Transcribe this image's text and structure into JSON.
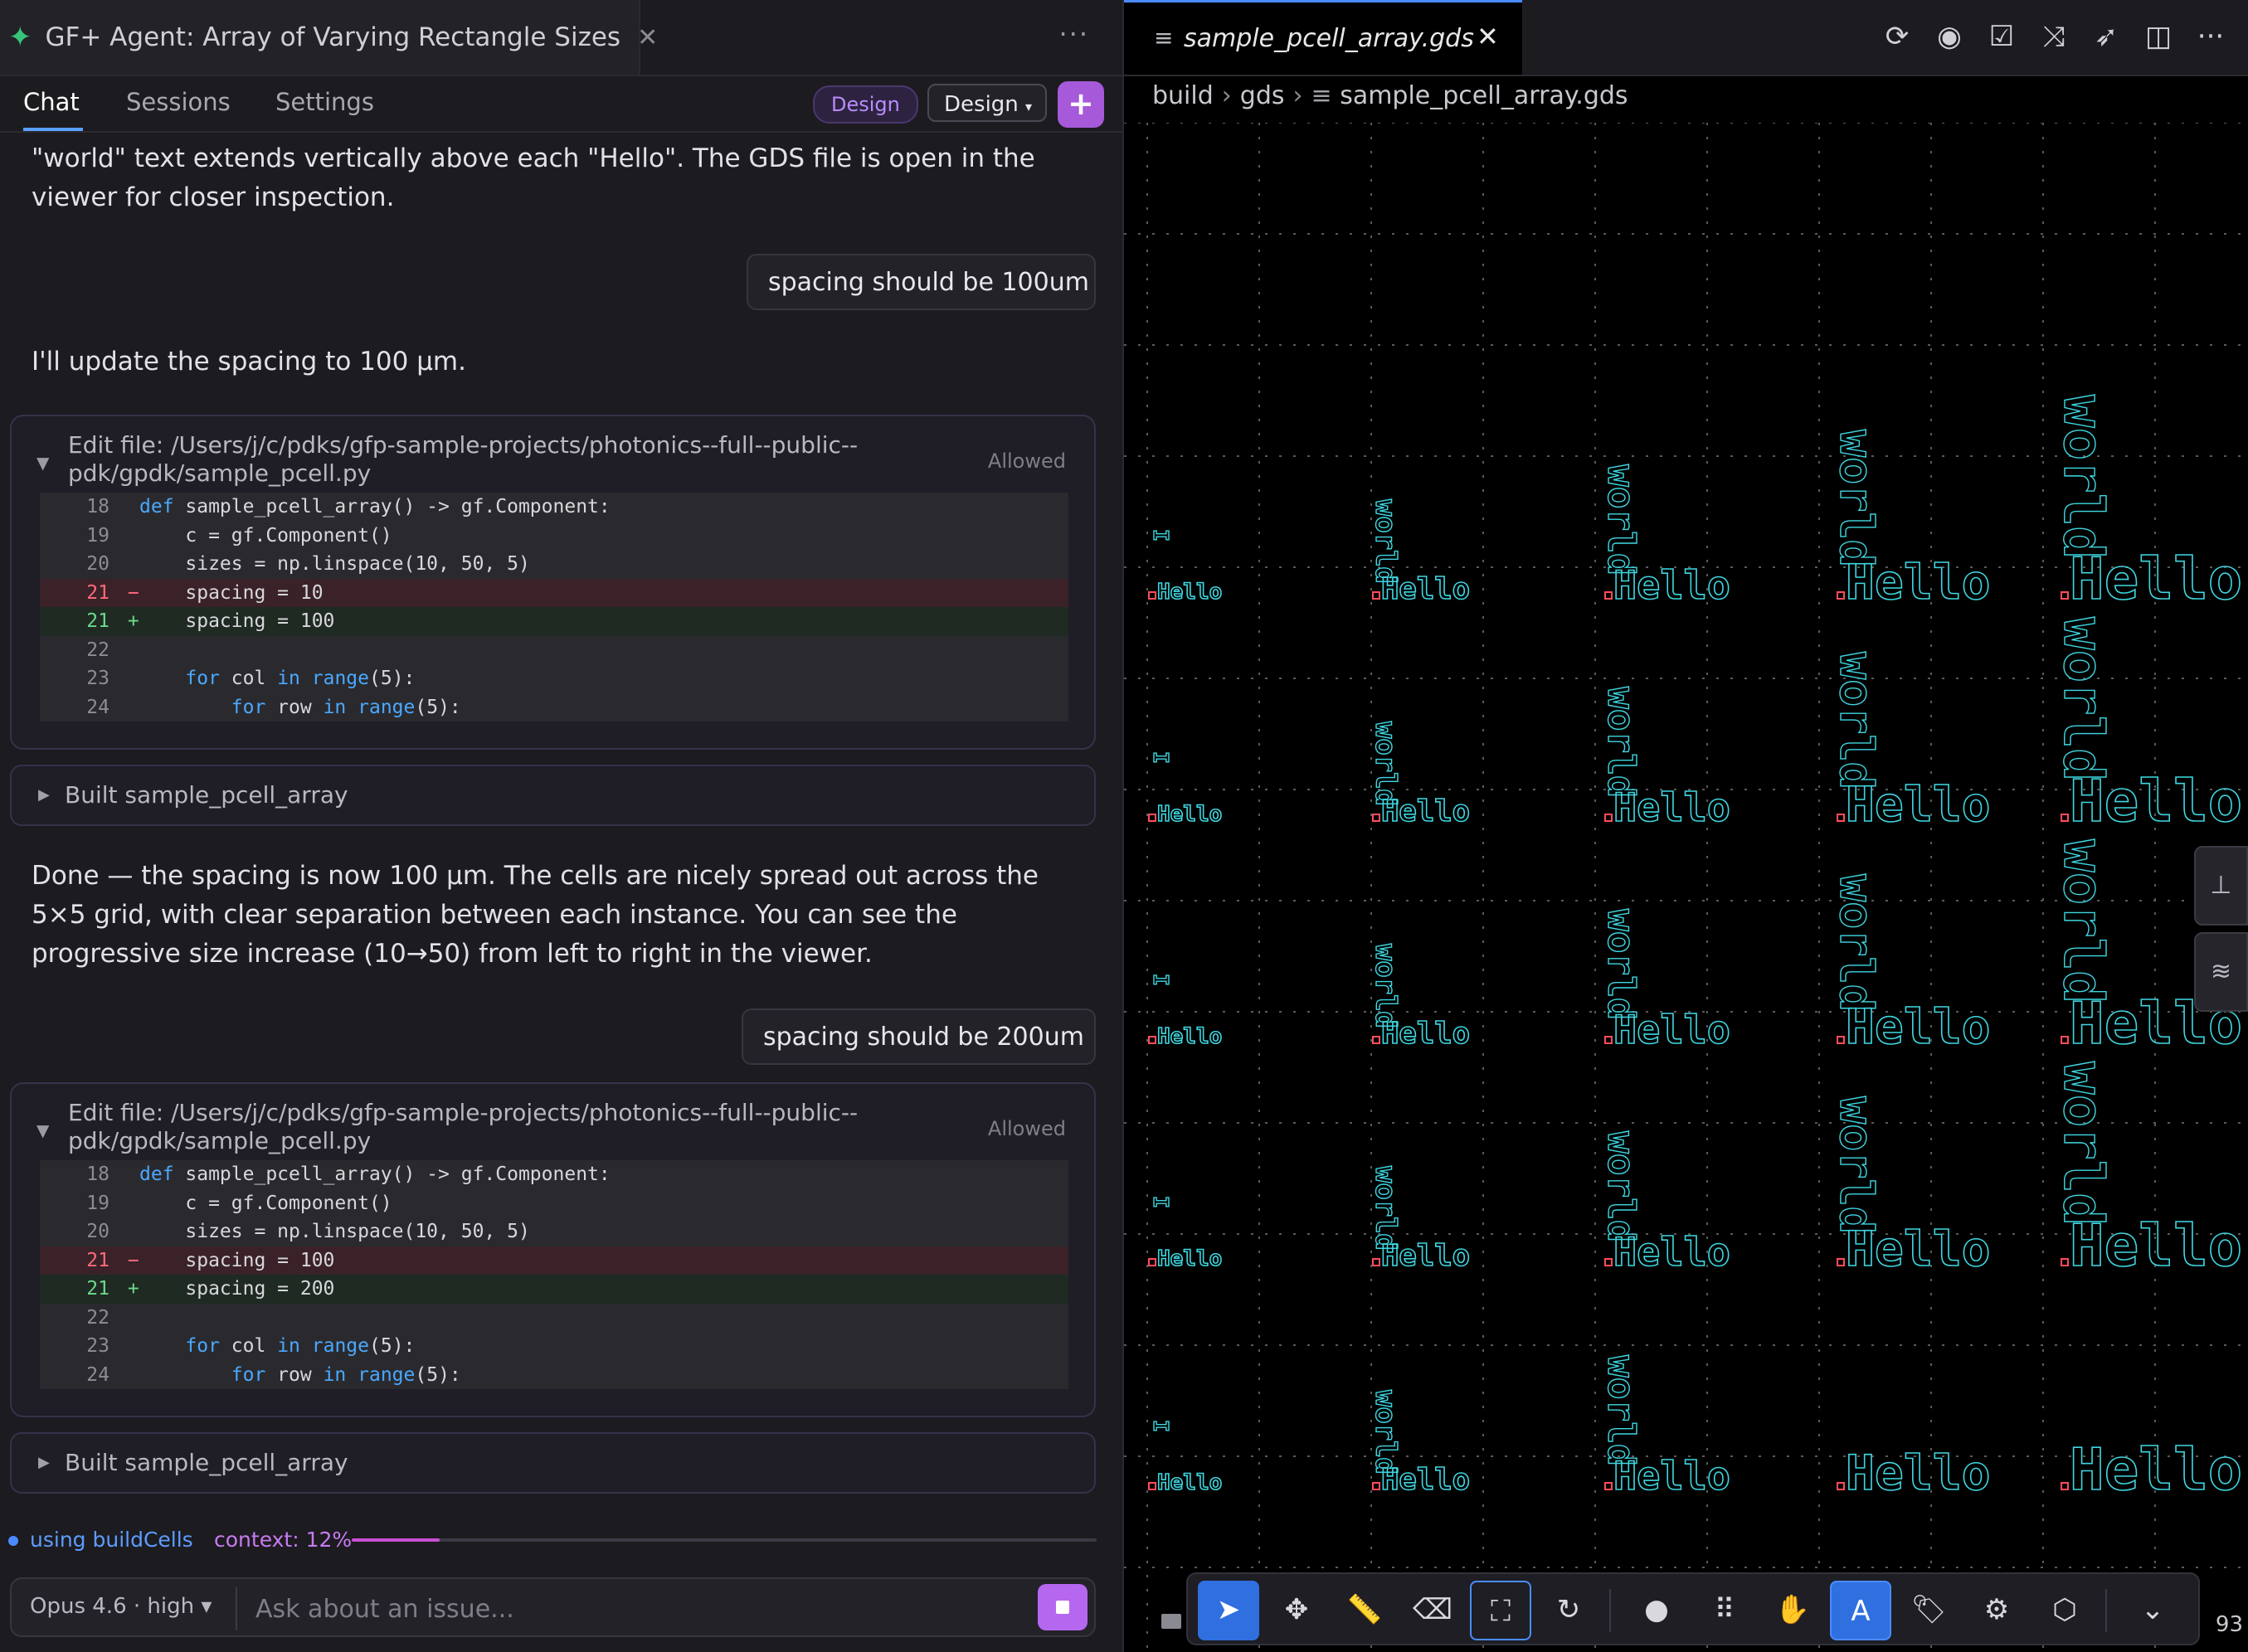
{
  "left": {
    "agent_tab_title": "GF+ Agent: Array of Varying Rectangle Sizes",
    "more": "···",
    "subtabs": [
      "Chat",
      "Sessions",
      "Settings"
    ],
    "mode_pill": "Design",
    "mode_dropdown": "Design",
    "plus": "+",
    "intro_text": "\"world\" text extends vertically above each \"Hello\". The GDS file is open in the viewer for closer inspection.",
    "user_msg_1": "spacing should be 100um",
    "assistant_1": "I'll update the spacing to 100 µm.",
    "edit_1": {
      "title": "Edit file: /Users/j/c/pdks/gfp-sample-projects/photonics--full--public--pdk/gpdk/sample_pcell.py",
      "status": "Allowed",
      "lines": [
        {
          "num": "18",
          "mark": "",
          "kind": "ctx",
          "code": "def sample_pcell_array() -> gf.Component:"
        },
        {
          "num": "19",
          "mark": "",
          "kind": "ctx",
          "code": "    c = gf.Component()"
        },
        {
          "num": "20",
          "mark": "",
          "kind": "ctx",
          "code": "    sizes = np.linspace(10, 50, 5)"
        },
        {
          "num": "21",
          "mark": "−",
          "kind": "del",
          "code": "    spacing = 10"
        },
        {
          "num": "21",
          "mark": "+",
          "kind": "add",
          "code": "    spacing = 100"
        },
        {
          "num": "22",
          "mark": "",
          "kind": "ctx",
          "code": ""
        },
        {
          "num": "23",
          "mark": "",
          "kind": "ctx",
          "code": "    for col in range(5):"
        },
        {
          "num": "24",
          "mark": "",
          "kind": "ctx",
          "code": "        for row in range(5):"
        }
      ]
    },
    "built_1": "Built sample_pcell_array",
    "assistant_2": "Done — the spacing is now 100 µm. The cells are nicely spread out across the 5×5 grid, with clear separation between each instance. You can see the progressive size increase (10→50) from left to right in the viewer.",
    "user_msg_2": "spacing should be 200um",
    "edit_2": {
      "title": "Edit file: /Users/j/c/pdks/gfp-sample-projects/photonics--full--public--pdk/gpdk/sample_pcell.py",
      "status": "Allowed",
      "lines": [
        {
          "num": "18",
          "mark": "",
          "kind": "ctx",
          "code": "def sample_pcell_array() -> gf.Component:"
        },
        {
          "num": "19",
          "mark": "",
          "kind": "ctx",
          "code": "    c = gf.Component()"
        },
        {
          "num": "20",
          "mark": "",
          "kind": "ctx",
          "code": "    sizes = np.linspace(10, 50, 5)"
        },
        {
          "num": "21",
          "mark": "−",
          "kind": "del",
          "code": "    spacing = 100"
        },
        {
          "num": "21",
          "mark": "+",
          "kind": "add",
          "code": "    spacing = 200"
        },
        {
          "num": "22",
          "mark": "",
          "kind": "ctx",
          "code": ""
        },
        {
          "num": "23",
          "mark": "",
          "kind": "ctx",
          "code": "    for col in range(5):"
        },
        {
          "num": "24",
          "mark": "",
          "kind": "ctx",
          "code": "        for row in range(5):"
        }
      ]
    },
    "built_2": "Built sample_pcell_array",
    "status_using": "using buildCells",
    "status_context": "context: 12%",
    "context_fraction": 0.12,
    "model_selector": "Opus 4.6 · high ▾",
    "ask_placeholder": "Ask about an issue..."
  },
  "right": {
    "file_tab": "sample_pcell_array.gds",
    "breadcrumb": [
      "build",
      "gds",
      "sample_pcell_array.gds"
    ],
    "toolbar_icons": [
      "reload-icon",
      "eye-icon",
      "check-icon",
      "shuffle-icon",
      "rocket-icon",
      "split-icon",
      "more-icon"
    ],
    "tools": [
      "select-icon",
      "move-icon",
      "ruler-icon",
      "eraser-icon",
      "fit-icon",
      "rotate-icon",
      "circle-icon",
      "grid-icon",
      "hand-icon",
      "text-icon",
      "tag-icon",
      "gear-icon",
      "cube-icon",
      "chevron-down-icon"
    ],
    "page_number": "93",
    "layout_colors": {
      "shape": "#3fd6e0",
      "port": "#ff4d5a",
      "grid": "#5a5a5a"
    }
  }
}
